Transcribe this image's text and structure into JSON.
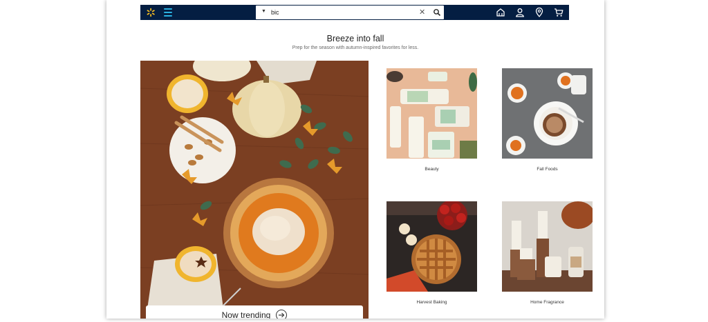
{
  "header": {
    "search": {
      "value": "bic",
      "dropdown_icon": "caret-down-icon",
      "clear_icon": "clear-icon",
      "submit_icon": "search-icon"
    },
    "icons": [
      "reorder-icon",
      "account-icon",
      "location-icon",
      "cart-icon"
    ],
    "brand_color": "#041e42",
    "accent_color": "#ffc220"
  },
  "section": {
    "title": "Breeze into fall",
    "subtitle": "Prep for the season with autumn-inspired favorites for less."
  },
  "hero": {
    "cta_label": "Now trending"
  },
  "tiles": [
    {
      "label": "Beauty"
    },
    {
      "label": "Fall Foods"
    },
    {
      "label": "Harvest Baking"
    },
    {
      "label": "Home Fragrance"
    }
  ]
}
